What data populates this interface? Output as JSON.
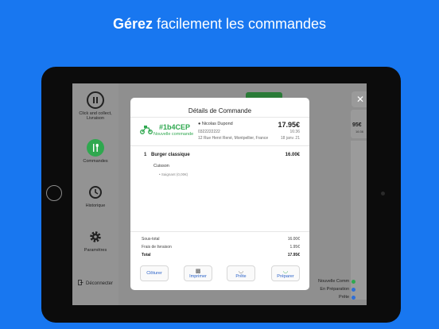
{
  "headline": {
    "bold": "Gérez",
    "rest": " facilement les commandes"
  },
  "sidebar": {
    "items": [
      {
        "label": "Click and collect, Livraison",
        "icon": "pause-icon"
      },
      {
        "label": "Commandes",
        "icon": "fork-knife-icon"
      },
      {
        "label": "Historique",
        "icon": "history-icon"
      },
      {
        "label": "Paramètres",
        "icon": "gear-icon"
      }
    ],
    "disconnect": "Déconnecter"
  },
  "background": {
    "price": "95€",
    "sub": "16:36"
  },
  "legend": [
    {
      "label": "Nouvelle Comm",
      "color": "#2fa84f"
    },
    {
      "label": "En Préparation",
      "color": "#2f6fd6"
    },
    {
      "label": "Prête",
      "color": "#2f6fd6"
    }
  ],
  "modal": {
    "title": "Détails de Commande",
    "order_number": "#1b4CEP",
    "order_status": "Nouvelle commande",
    "customer": {
      "name": "Nicolas Dupond",
      "phone": "0322222222",
      "address": "12 Rue Henri René, Montpellier, France"
    },
    "price": "17.95€",
    "time": "16:36",
    "date": "18 janv. 21",
    "item": {
      "qty": "1",
      "name": "Burger classique",
      "price": "16.00€"
    },
    "option": {
      "title": "Cuisson",
      "value": "Saignant (0,00€)"
    },
    "totals": [
      {
        "label": "Sous-total",
        "value": "16.00€"
      },
      {
        "label": "Frais de livraison",
        "value": "1.95€"
      },
      {
        "label": "Total",
        "value": "17.95€"
      }
    ],
    "buttons": [
      {
        "label": "Clôturer",
        "icon": ""
      },
      {
        "label": "Imprimer",
        "icon": "printer-icon"
      },
      {
        "label": "Prête",
        "icon": "dish-icon"
      },
      {
        "label": "Préparer",
        "icon": "dish-icon"
      }
    ]
  },
  "colors": {
    "brand_blue": "#1877f0",
    "accent_green": "#2fa84f",
    "link_blue": "#2a62c9"
  }
}
